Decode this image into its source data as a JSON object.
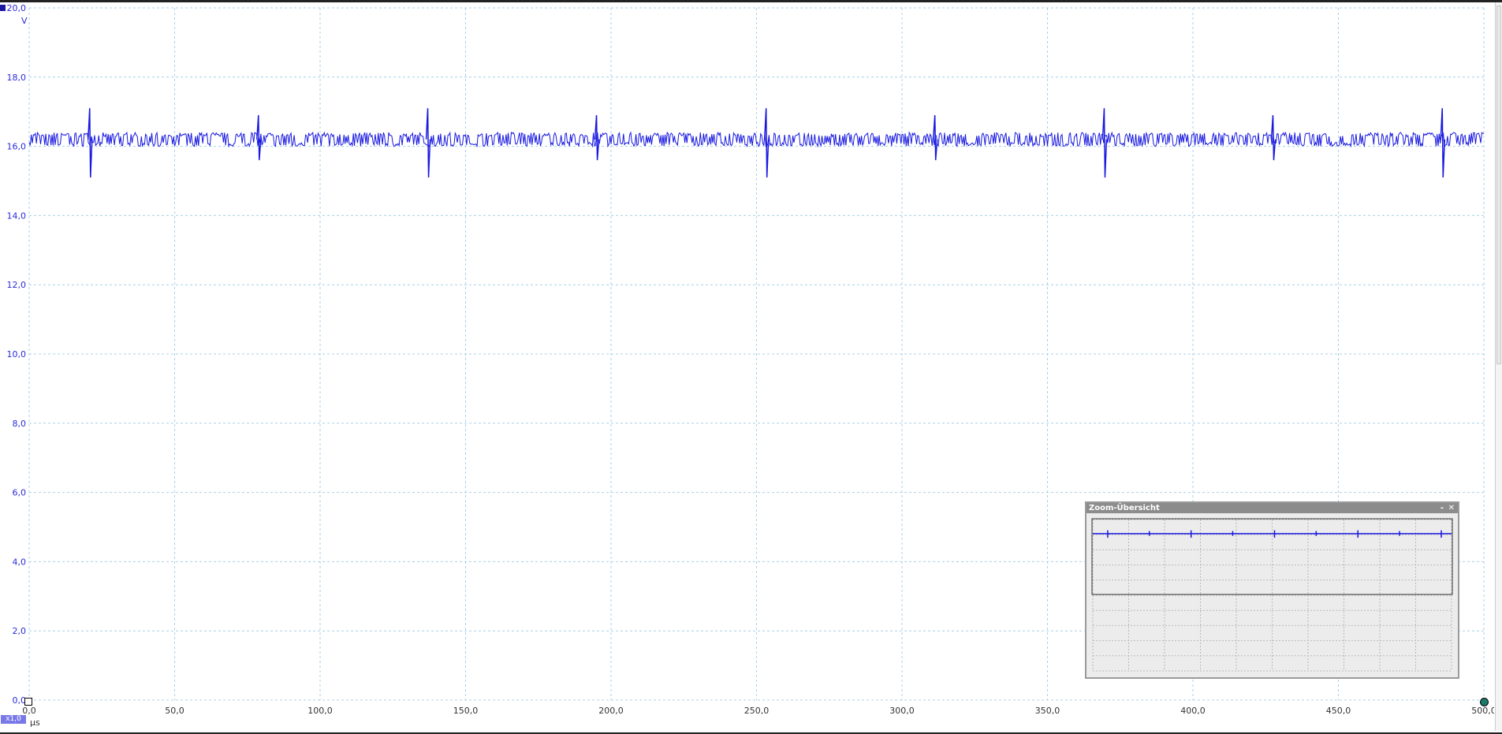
{
  "channel": {
    "badge_color": "#1a1aa0",
    "trace_color": "#1818e0",
    "grid_color": "#a8d0e8"
  },
  "units": {
    "y": "V",
    "x": "µs"
  },
  "zoom_factor": "x1,0",
  "zoom_panel": {
    "title": "Zoom-Übersicht",
    "minimize": "-",
    "close": "✕"
  },
  "chart_data": {
    "type": "line",
    "title": "",
    "xlabel": "µs",
    "ylabel": "V",
    "xlim": [
      0,
      500
    ],
    "ylim": [
      0,
      20
    ],
    "x_ticks": [
      0,
      50,
      100,
      150,
      200,
      250,
      300,
      350,
      400,
      450,
      500
    ],
    "x_tick_labels": [
      "0,0",
      "50,0",
      "100,0",
      "150,0",
      "200,0",
      "250,0",
      "300,0",
      "350,0",
      "400,0",
      "450,0",
      "500,0"
    ],
    "y_ticks": [
      0,
      2,
      4,
      6,
      8,
      10,
      12,
      14,
      16,
      18,
      20
    ],
    "y_tick_labels": [
      "0,0",
      "2,0",
      "4,0",
      "6,0",
      "8,0",
      "10,0",
      "12,0",
      "14,0",
      "16,0",
      "18,0",
      "20,0"
    ],
    "grid": true,
    "series": [
      {
        "baseline": 16.2,
        "noise_band": [
          16.0,
          16.4
        ],
        "spikes": [
          {
            "x": 20.8,
            "max": 17.1,
            "min": 15.1
          },
          {
            "x": 78.8,
            "max": 16.9,
            "min": 15.6
          },
          {
            "x": 137.0,
            "max": 17.1,
            "min": 15.1
          },
          {
            "x": 195.0,
            "max": 16.9,
            "min": 15.6
          },
          {
            "x": 253.3,
            "max": 17.1,
            "min": 15.1
          },
          {
            "x": 311.3,
            "max": 16.9,
            "min": 15.6
          },
          {
            "x": 369.5,
            "max": 17.1,
            "min": 15.1
          },
          {
            "x": 427.5,
            "max": 16.9,
            "min": 15.6
          },
          {
            "x": 485.7,
            "max": 17.1,
            "min": 15.1
          }
        ]
      }
    ]
  }
}
